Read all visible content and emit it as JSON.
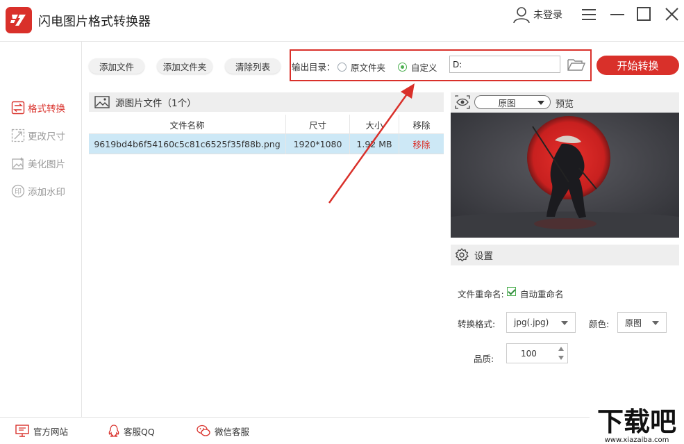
{
  "app": {
    "title": "闪电图片格式转换器",
    "user_label": "未登录",
    "brand_color": "#d9302a"
  },
  "window_controls": [
    "menu-icon",
    "minimize-icon",
    "maximize-icon",
    "close-icon"
  ],
  "sidebar": {
    "items": [
      {
        "label": "格式转换",
        "icon": "convert-icon",
        "active": true
      },
      {
        "label": "更改尺寸",
        "icon": "resize-icon",
        "active": false
      },
      {
        "label": "美化图片",
        "icon": "beautify-icon",
        "active": false
      },
      {
        "label": "添加水印",
        "icon": "watermark-icon",
        "active": false
      }
    ]
  },
  "toolbar": {
    "add_file": "添加文件",
    "add_folder": "添加文件夹",
    "clear_list": "清除列表",
    "output_label": "输出目录：",
    "radio_original": "原文件夹",
    "radio_custom": "自定义",
    "output_path": "D:",
    "start_button": "开始转换",
    "selected_output": "自定义"
  },
  "source_panel": {
    "title": "源图片文件（1个）",
    "columns": [
      "文件名称",
      "尺寸",
      "大小",
      "移除"
    ],
    "rows": [
      {
        "name": "9619bd4b6f54160c5c81c6525f35f88b.png",
        "size": "1920*1080",
        "bytes": "1.92 MB",
        "remove": "移除"
      }
    ]
  },
  "preview": {
    "mode_option": "原图",
    "label": "预览"
  },
  "settings": {
    "title": "设置",
    "rename_label": "文件重命名:",
    "auto_rename_label": "自动重命名",
    "auto_rename_checked": true,
    "format_label": "转换格式:",
    "format_value": "jpg(.jpg)",
    "color_label": "颜色:",
    "color_value": "原图",
    "quality_label": "品质:",
    "quality_value": "100"
  },
  "footer": {
    "website": "官方网站",
    "qq_service": "客服QQ",
    "wechat_service": "微信客服"
  },
  "watermark": {
    "text": "下载吧",
    "url": "www.xiazaiba.com"
  }
}
